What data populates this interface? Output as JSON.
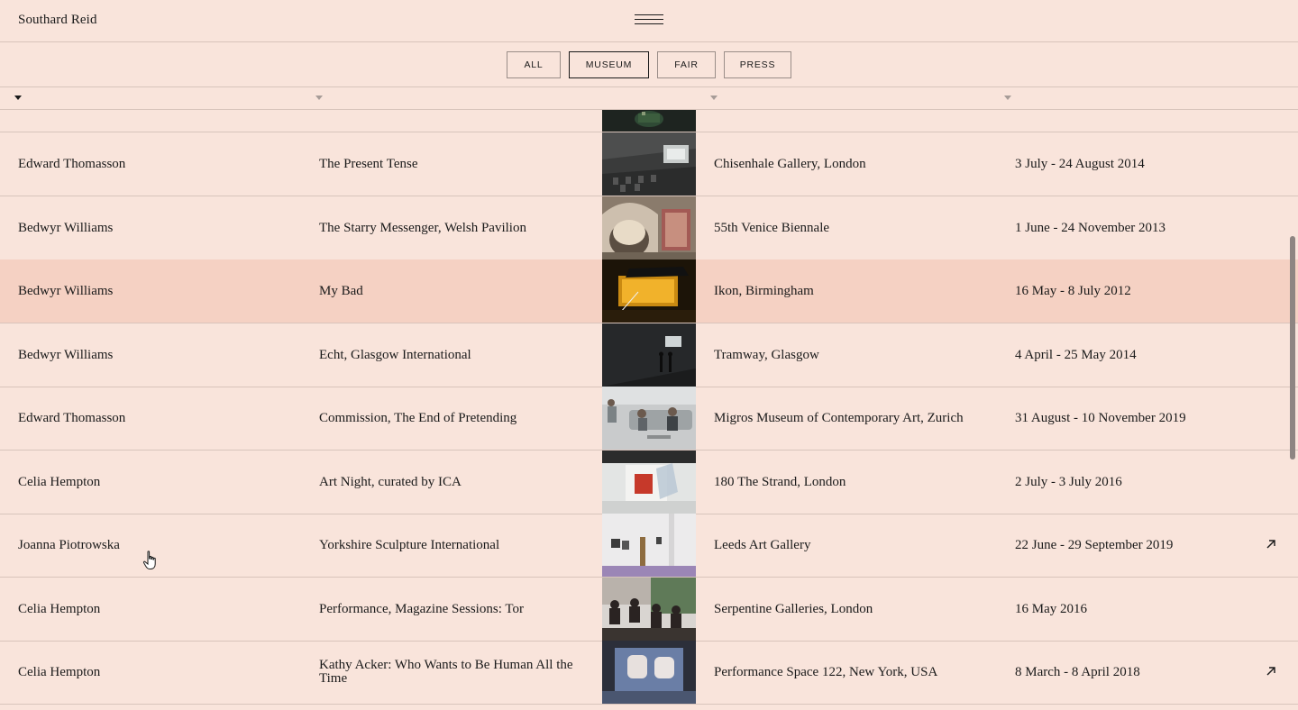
{
  "header": {
    "brand": "Southard Reid"
  },
  "filters": [
    {
      "label": "ALL",
      "active": false
    },
    {
      "label": "MUSEUM",
      "active": true
    },
    {
      "label": "FAIR",
      "active": false
    },
    {
      "label": "PRESS",
      "active": false
    }
  ],
  "rows": [
    {
      "artist": "Edward Thomasson",
      "title": "The Present Tense",
      "venue": "Chisenhale Gallery, London",
      "dates": "3 July - 24 August 2014",
      "thumb": "dark gallery with projection screen"
    },
    {
      "artist": "Bedwyr Williams",
      "title": "The Starry Messenger, Welsh Pavilion",
      "venue": "55th Venice Biennale",
      "dates": "1 June - 24 November 2013",
      "thumb": "domed observatory with carpet"
    },
    {
      "artist": "Bedwyr Williams",
      "title": "My Bad",
      "venue": "Ikon, Birmingham",
      "dates": "16 May - 8 July 2012",
      "thumb": "amber lit installation",
      "highlighted": true
    },
    {
      "artist": "Bedwyr Williams",
      "title": "Echt, Glasgow International",
      "venue": "Tramway, Glasgow",
      "dates": "4 April - 25 May 2014",
      "thumb": "dark room with viewers"
    },
    {
      "artist": "Edward Thomasson",
      "title": "Commission, The End of Pretending",
      "venue": "Migros Museum of Contemporary Art, Zurich",
      "dates": "31 August - 10 November 2019",
      "thumb": "performers on sofa"
    },
    {
      "artist": "Celia Hempton",
      "title": "Art Night, curated by ICA",
      "venue": "180 The Strand, London",
      "dates": "2 July - 3 July 2016",
      "thumb": "red painting installation"
    },
    {
      "artist": "Joanna Piotrowska",
      "title": "Yorkshire Sculpture International",
      "venue": "Leeds Art Gallery",
      "dates": "22 June - 29 September 2019",
      "thumb": "white gallery purple floor",
      "link": true
    },
    {
      "artist": "Celia Hempton",
      "title": "Performance, Magazine Sessions: Tor",
      "venue": "Serpentine Galleries, London",
      "dates": "16 May 2016",
      "thumb": "audience seated"
    },
    {
      "artist": "Celia Hempton",
      "title": "Kathy Acker: Who Wants to Be Human All the Time",
      "venue": "Performance Space 122, New York, USA",
      "dates": "8 March - 8 April 2018",
      "thumb": "projection of faces",
      "link": true
    }
  ],
  "icons": {
    "menu": "hamburger-icon",
    "sort": "triangle-down-icon",
    "external": "arrow-up-right-icon",
    "cursor": "hand-pointer-icon"
  },
  "colors": {
    "background": "#f9e4db",
    "highlight_row": "#f5d1c3",
    "border": "#d8c4bb",
    "text": "#1a1a1a"
  }
}
